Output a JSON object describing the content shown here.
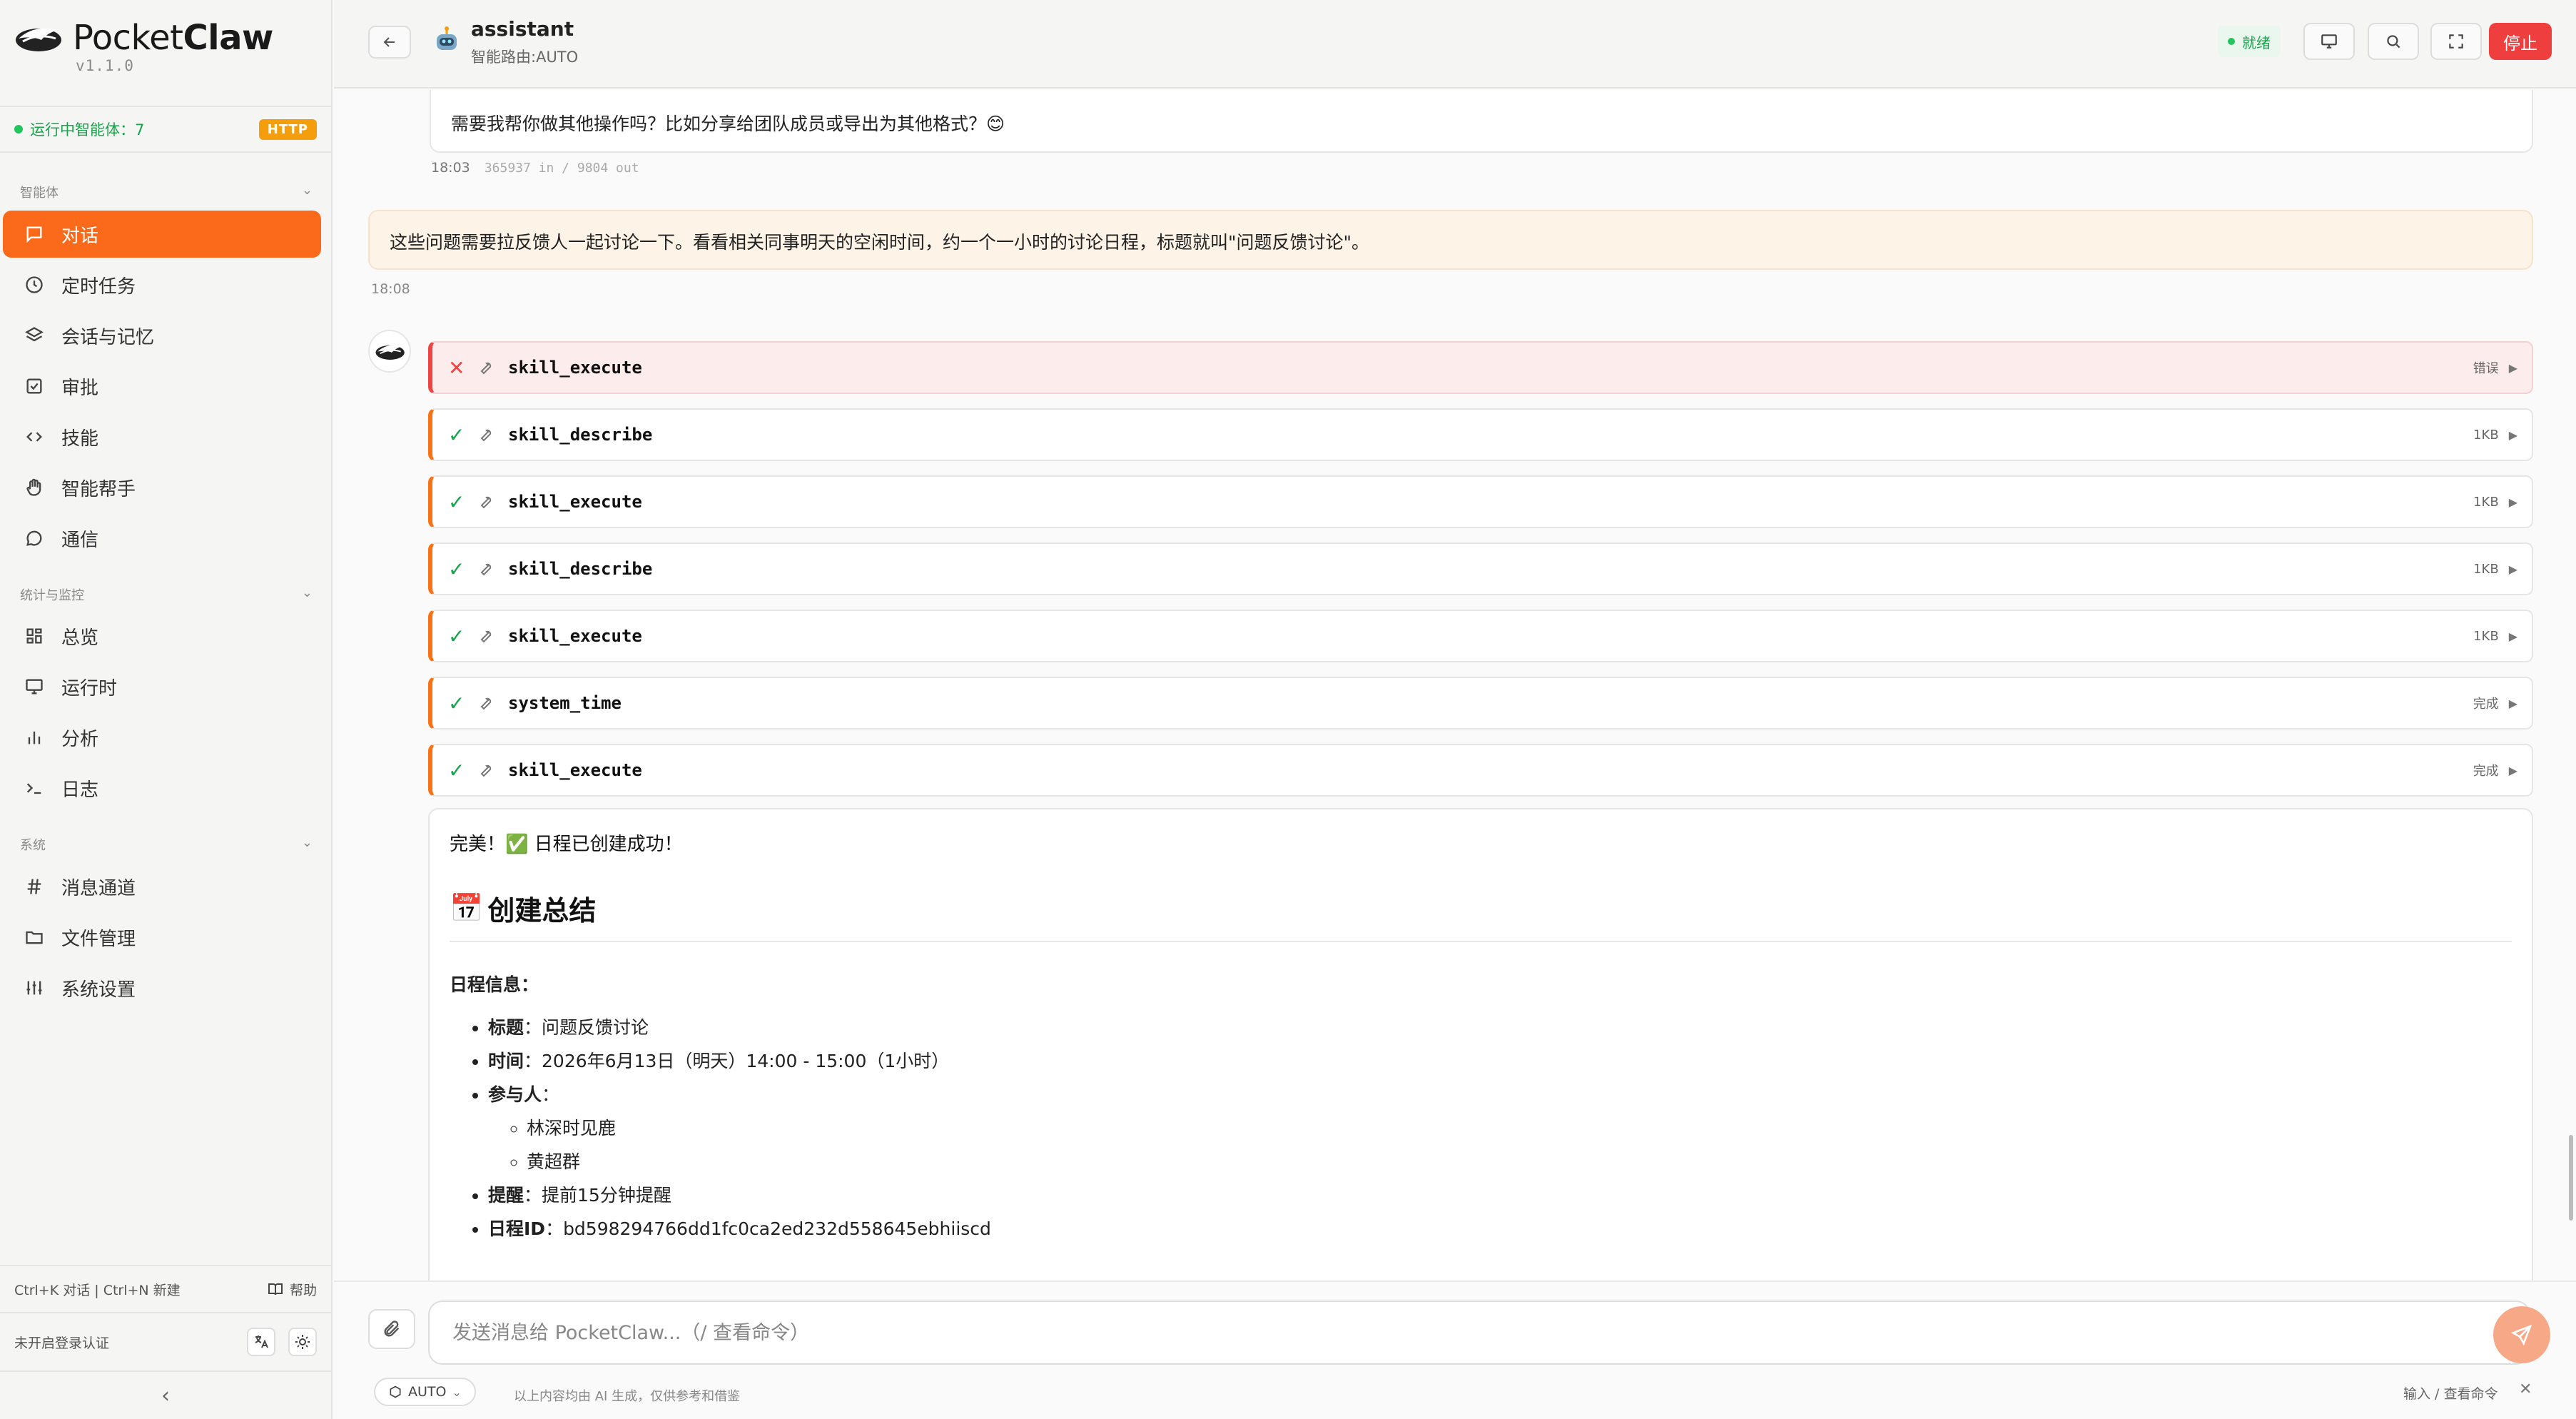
{
  "sidebar": {
    "brand_plain": "Pocket",
    "brand_bold": "Claw",
    "version": "v1.1.0",
    "running_label": "运行中智能体：7",
    "protocol_badge": "HTTP",
    "sections": [
      {
        "title": "智能体",
        "items": [
          {
            "label": "对话",
            "icon": "chat-icon",
            "active": true
          },
          {
            "label": "定时任务",
            "icon": "clock-icon"
          },
          {
            "label": "会话与记忆",
            "icon": "layers-icon"
          },
          {
            "label": "审批",
            "icon": "check-square-icon"
          },
          {
            "label": "技能",
            "icon": "code-icon"
          },
          {
            "label": "智能帮手",
            "icon": "hand-icon"
          },
          {
            "label": "通信",
            "icon": "message-circle-icon"
          }
        ]
      },
      {
        "title": "统计与监控",
        "items": [
          {
            "label": "总览",
            "icon": "dashboard-icon"
          },
          {
            "label": "运行时",
            "icon": "monitor-icon"
          },
          {
            "label": "分析",
            "icon": "bar-chart-icon"
          },
          {
            "label": "日志",
            "icon": "terminal-icon"
          }
        ]
      },
      {
        "title": "系统",
        "items": [
          {
            "label": "消息通道",
            "icon": "hash-icon"
          },
          {
            "label": "文件管理",
            "icon": "folder-icon"
          },
          {
            "label": "系统设置",
            "icon": "sliders-icon"
          }
        ]
      }
    ],
    "shortcuts": "Ctrl+K 对话 | Ctrl+N 新建",
    "help_label": "帮助",
    "auth_status": "未开启登录认证"
  },
  "topbar": {
    "agent_name": "assistant",
    "route_label": "智能路由:AUTO",
    "status_badge": "就绪",
    "stop_label": "停止"
  },
  "chat": {
    "prev_assistant_text": "需要我帮你做其他操作吗？比如分享给团队成员或导出为其他格式？😊",
    "prev_time": "18:03",
    "prev_tokens": "365937 in / 9804 out",
    "user_text": "这些问题需要拉反馈人一起讨论一下。看看相关同事明天的空闲时间，约一个一小时的讨论日程，标题就叫\"问题反馈讨论\"。",
    "user_time": "18:08",
    "tool_calls": [
      {
        "name": "skill_execute",
        "status": "error",
        "meta": "错误"
      },
      {
        "name": "skill_describe",
        "status": "ok",
        "meta": "1KB"
      },
      {
        "name": "skill_execute",
        "status": "ok",
        "meta": "1KB"
      },
      {
        "name": "skill_describe",
        "status": "ok",
        "meta": "1KB"
      },
      {
        "name": "skill_execute",
        "status": "ok",
        "meta": "1KB"
      },
      {
        "name": "system_time",
        "status": "ok",
        "meta": "完成"
      },
      {
        "name": "skill_execute",
        "status": "ok",
        "meta": "完成"
      }
    ],
    "result": {
      "intro": "完美！✅ 日程已创建成功！",
      "heading_emoji": "📅",
      "heading": "创建总结",
      "info_label": "日程信息：",
      "title_key": "标题",
      "title_value": "：问题反馈讨论",
      "time_key": "时间",
      "time_value": "：2026年6月13日（明天）14:00 - 15:00（1小时）",
      "participants_key": "参与人",
      "participants_suffix": "：",
      "participants": [
        "林深时见鹿",
        "黄超群"
      ],
      "reminder_key": "提醒",
      "reminder_value": "：提前15分钟提醒",
      "id_key": "日程ID",
      "id_value": "：bd598294766dd1fc0ca2ed232d558645ebhiiscd"
    }
  },
  "composer": {
    "placeholder": "发送消息给 PocketClaw...（/ 查看命令）",
    "mode": "AUTO",
    "disclaimer": "以上内容均由 AI 生成，仅供参考和借鉴",
    "hint": "输入 / 查看命令"
  },
  "colors": {
    "accent": "#fa6a1a",
    "stop": "#ef3e3e",
    "ok": "#16a34a",
    "error": "#ef4444"
  }
}
